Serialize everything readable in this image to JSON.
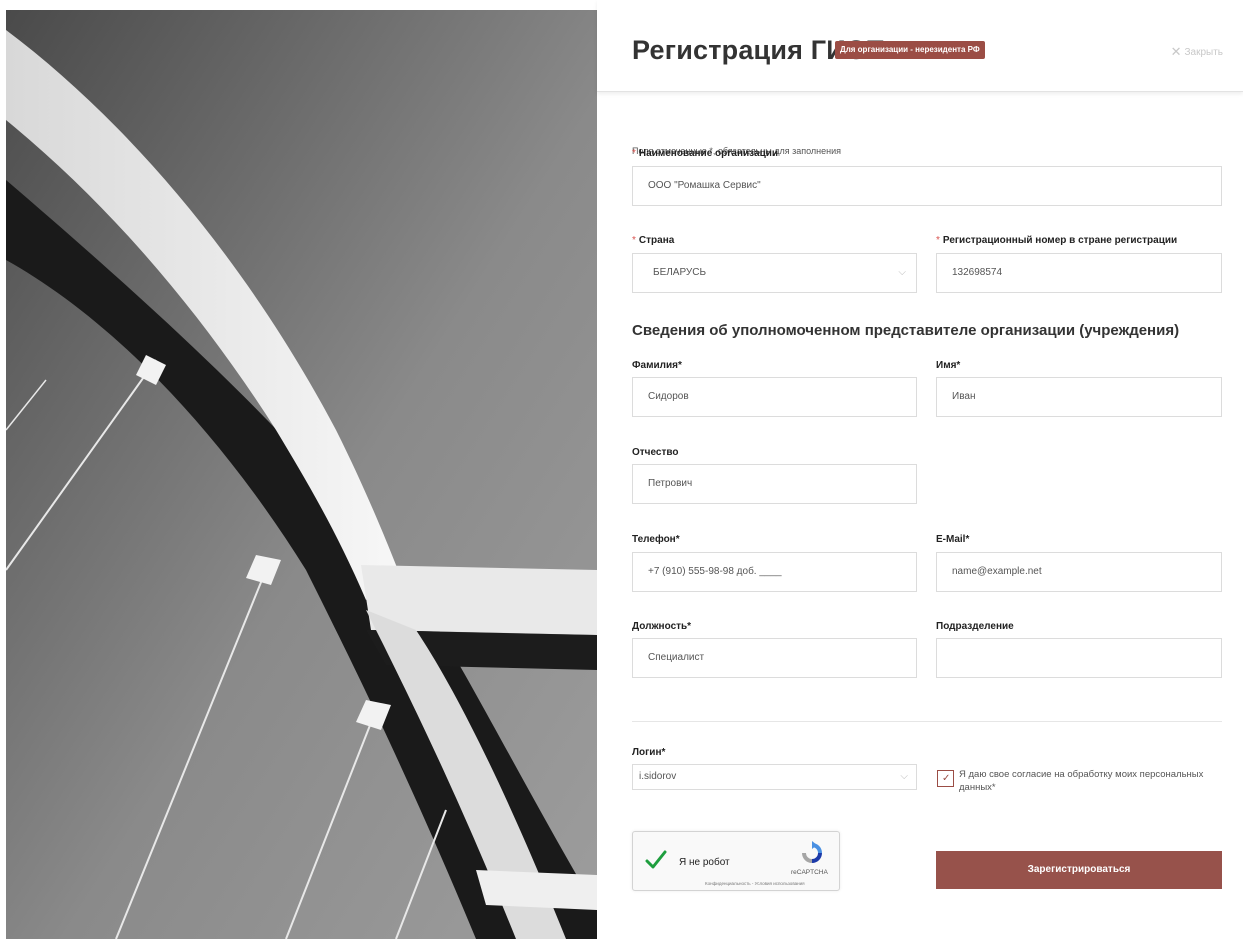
{
  "header": {
    "title": "Регистрация ГИСП",
    "badge": "Для организации - нерезидента РФ",
    "close_label": "Закрыть"
  },
  "form": {
    "required_note": "Поля отмеченные *, обязательны для заполнения",
    "required_mark": "*",
    "organization": {
      "label": "Наименование организации",
      "value": "ООО \"Ромашка Сервис\""
    },
    "country": {
      "label": "Страна",
      "value": "БЕЛАРУСЬ"
    },
    "reg_number": {
      "label": "Регистрационный номер в стране регистрации",
      "value": "132698574"
    },
    "section_title": "Сведения об уполномоченном представителе организации (учреждения)",
    "last_name": {
      "label": "Фамилия*",
      "value": "Сидоров"
    },
    "first_name": {
      "label": "Имя*",
      "value": "Иван"
    },
    "patronymic": {
      "label": "Отчество",
      "value": "Петрович"
    },
    "phone": {
      "label": "Телефон*",
      "value": "+7 (910) 555-98-98 доб. ____"
    },
    "email": {
      "label": "E-Mail*",
      "value": "name@example.net"
    },
    "position": {
      "label": "Должность*",
      "value": "Специалист"
    },
    "department": {
      "label": "Подразделение",
      "value": ""
    },
    "login": {
      "label": "Логин*",
      "value": "i.sidorov"
    },
    "consent": {
      "text": "Я даю свое согласие на обработку моих персональных данных*",
      "checked": true
    },
    "captcha": {
      "label": "Я не робот",
      "brand": "reCAPTCHA",
      "terms": "Конфиденциальность - Условия использования"
    },
    "submit_label": "Зарегистрироваться"
  },
  "colors": {
    "accent": "#97524b",
    "required": "#d9534f",
    "captcha_check": "#1e9e3e"
  },
  "icons": {
    "close": "close-x-icon",
    "select": "chevron-down-icon",
    "consent": "checkmark-icon",
    "captcha_check": "green-check-icon",
    "captcha_logo": "recaptcha-logo-icon"
  }
}
